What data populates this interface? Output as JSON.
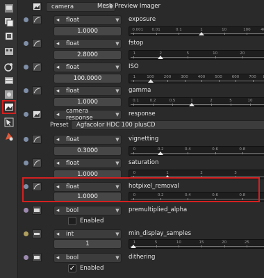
{
  "window": {
    "title": "Mesh Preview Imager",
    "camera_node": "camera"
  },
  "sidebar": {
    "icons": [
      "layers-icon",
      "copy-icon",
      "render-icon",
      "grid-icon",
      "gradient-icon",
      "link-icon",
      "panel-icon",
      "texture-icon",
      "image-icon",
      "cursor-icon",
      "material-icon"
    ]
  },
  "params": [
    {
      "type": "float",
      "name": "exposure",
      "value": "1.0000",
      "ticks": [
        "0.001",
        "0.01",
        "0.1",
        "1",
        "10",
        "100",
        "4096"
      ],
      "handle_tick": 3,
      "dot": "#7f8fa8"
    },
    {
      "type": "float",
      "name": "fstop",
      "value": "2.8000",
      "ticks": [
        "1",
        "2",
        "5",
        "10",
        "20",
        "64"
      ],
      "handle_tick": 1,
      "dot": "#7f8fa8"
    },
    {
      "type": "float",
      "name": "ISO",
      "value": "100.0000",
      "ticks": [
        "1",
        "100",
        "200",
        "300",
        "400",
        "500",
        "600",
        "700",
        "800"
      ],
      "handle_tick": 1,
      "dot": "#7f8fa8"
    },
    {
      "type": "float",
      "name": "gamma",
      "value": "1.0000",
      "ticks": [
        "0.1",
        "0.2",
        "0.5",
        "1",
        "2",
        "5",
        "10",
        "32"
      ],
      "handle_tick": 3,
      "dot": "#7f8fa8"
    },
    {
      "type": "float",
      "name": "vignetting",
      "value": "0.3000",
      "ticks": [
        "0",
        "0.2",
        "0.4",
        "0.6",
        "0.8",
        "1"
      ],
      "handle_tick": 1,
      "dot": "#7f8fa8"
    },
    {
      "type": "float",
      "name": "saturation",
      "value": "1.0000",
      "ticks": [
        "0",
        "1",
        "2",
        "3",
        "4"
      ],
      "handle_tick": 1,
      "dot": "#7f8fa8"
    },
    {
      "type": "float",
      "name": "hotpixel_removal",
      "value": "1.0000",
      "ticks": [
        "0",
        "0.2",
        "0.4",
        "0.6",
        "0.8",
        "1"
      ],
      "handle_tick": 5,
      "dot": "#7f8fa8"
    }
  ],
  "response": {
    "type": "camera response",
    "name": "response",
    "preset_label": "Preset",
    "preset_value": "Agfacolor HDC 100 plusCD"
  },
  "premultiplied": {
    "type": "bool",
    "name": "premultiplied_alpha",
    "checkbox_label": "Enabled",
    "checked": false
  },
  "min_samples": {
    "type": "int",
    "name": "min_display_samples",
    "value": "1",
    "ticks": [
      "1",
      "5",
      "10",
      "15",
      "20",
      "25",
      "32"
    ]
  },
  "dithering": {
    "type": "bool",
    "name": "dithering",
    "checkbox_label": "Enabled",
    "checked": true
  },
  "colors": {
    "highlight": "#d42020",
    "accent_dot": "#7f8fa8",
    "bool_dot": "#9c8ab0",
    "int_dot": "#b0a060"
  }
}
